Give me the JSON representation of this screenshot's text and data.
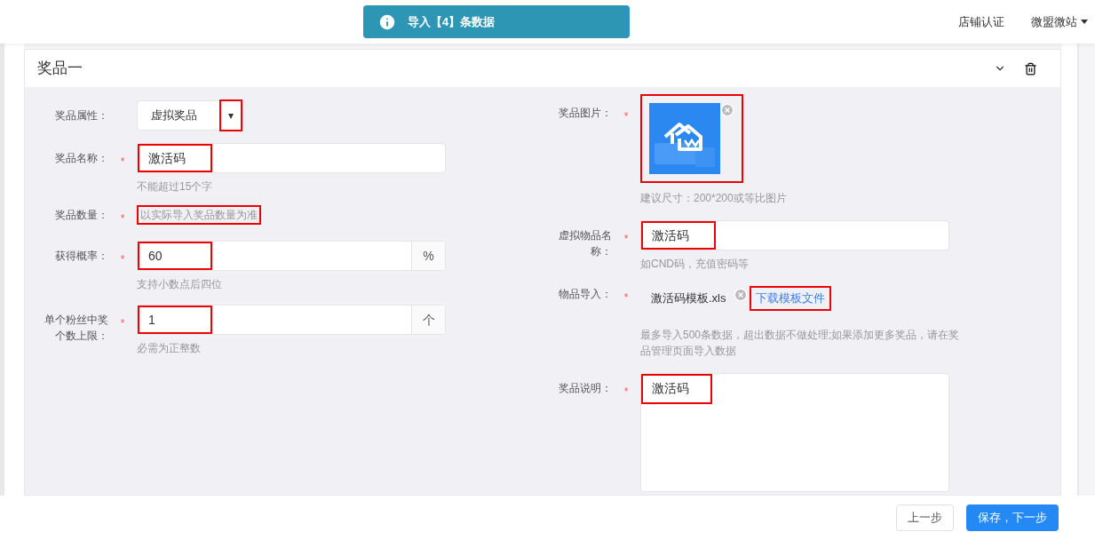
{
  "toast": {
    "text": "导入【4】条数据"
  },
  "nav": [
    {
      "label": "店铺认证",
      "has_menu": false
    },
    {
      "label": "微盟微站",
      "has_menu": true
    }
  ],
  "panel": {
    "title": "奖品一",
    "expanded": true
  },
  "left_fields": [
    {
      "kind": "select",
      "label": "奖品属性：",
      "value": "虚拟奖品",
      "arrow": "▾",
      "highlighted": true
    },
    {
      "kind": "input",
      "label": "奖品名称：",
      "required_mark": "*",
      "value": "激活码",
      "note": "不能超过15个字",
      "highlighted": true
    },
    {
      "kind": "text",
      "label": "奖品数量：",
      "required_mark": "*",
      "note": "以实际导入奖品数量为准",
      "highlighted": true
    },
    {
      "kind": "input",
      "label": "获得概率：",
      "required_mark": "*",
      "value": "60",
      "addon": "%",
      "note": "支持小数点后四位",
      "highlighted": true
    },
    {
      "kind": "input",
      "label": "单个粉丝中奖个数上限：",
      "required_mark": "*",
      "value": "1",
      "addon": "个",
      "note": "必需为正整数",
      "highlighted": true
    }
  ],
  "right_fields": [
    {
      "kind": "image",
      "label": "奖品图片：",
      "required_mark": "*",
      "note": "建议尺寸：200*200或等比图片",
      "highlighted": true
    },
    {
      "kind": "input",
      "label": "虚拟物品名称：",
      "required_mark": "*",
      "value": "激活码",
      "note": "如CND码，充值密码等",
      "highlighted": true
    },
    {
      "kind": "file",
      "label": "物品导入：",
      "required_mark": "*",
      "file": "激活码模板.xls",
      "link": "下载模板文件",
      "note": "最多导入500条数据，超出数据不做处理;如果添加更多奖品，请在奖品管理页面导入数据",
      "highlighted": true
    },
    {
      "kind": "textarea",
      "label": "奖品说明：",
      "required_mark": "*",
      "value": "激活码",
      "highlighted": true
    }
  ],
  "buttons": [
    {
      "label": "上一步",
      "primary": false
    },
    {
      "label": "保存，下一步",
      "primary": true
    }
  ]
}
